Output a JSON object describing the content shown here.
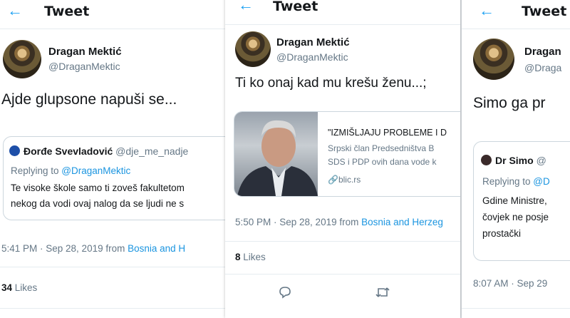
{
  "panels": [
    {
      "header_title": "Tweet",
      "author_name": "Dragan Mektić",
      "author_handle": "@DraganMektic",
      "text": "Ajde glupsone napuši se...",
      "quote": {
        "name": "Đorđe Svevladović",
        "handle": "@dje_me_nadje",
        "replying_prefix": "Replying to ",
        "replying_handle": "@DraganMektic",
        "lines": [
          "Te visoke škole samo ti zoveš fakultetom",
          "nekog da vodi ovaj nalog da se ljudi ne s"
        ]
      },
      "timestamp": "5:41 PM · Sep 28, 2019 from ",
      "location": "Bosnia and H",
      "likes_count": "34",
      "likes_label": "Likes"
    },
    {
      "header_title": "Tweet",
      "author_name": "Dragan Mektić",
      "author_handle": "@DraganMektic",
      "text": "Ti ko onaj kad mu krešu ženu...;",
      "card": {
        "title": "\"IZMIŠLJAJU PROBLEME I D",
        "desc_lines": [
          "Srpski član Predsedništva B",
          "SDS i PDP ovih dana vode k"
        ],
        "link": "blic.rs"
      },
      "timestamp": "5:50 PM · Sep 28, 2019 from ",
      "location": "Bosnia and Herzeg",
      "likes_count": "8",
      "likes_label": "Likes",
      "actions": [
        "reply",
        "retweet"
      ]
    },
    {
      "header_title": "Tweet",
      "author_name": "Dragan",
      "author_handle": "@Draga",
      "text": "Simo ga pr",
      "quote": {
        "name": "Dr Simo",
        "handle": "@",
        "replying_prefix": "Replying to ",
        "replying_handle": "@D",
        "lines": [
          "Gdine Ministre,",
          "čovjek ne posje",
          "prostački"
        ]
      },
      "timestamp": "8:07 AM · Sep 29"
    }
  ],
  "colors": {
    "accent": "#1da1f2",
    "link": "#1b95e0",
    "muted": "#657786"
  }
}
